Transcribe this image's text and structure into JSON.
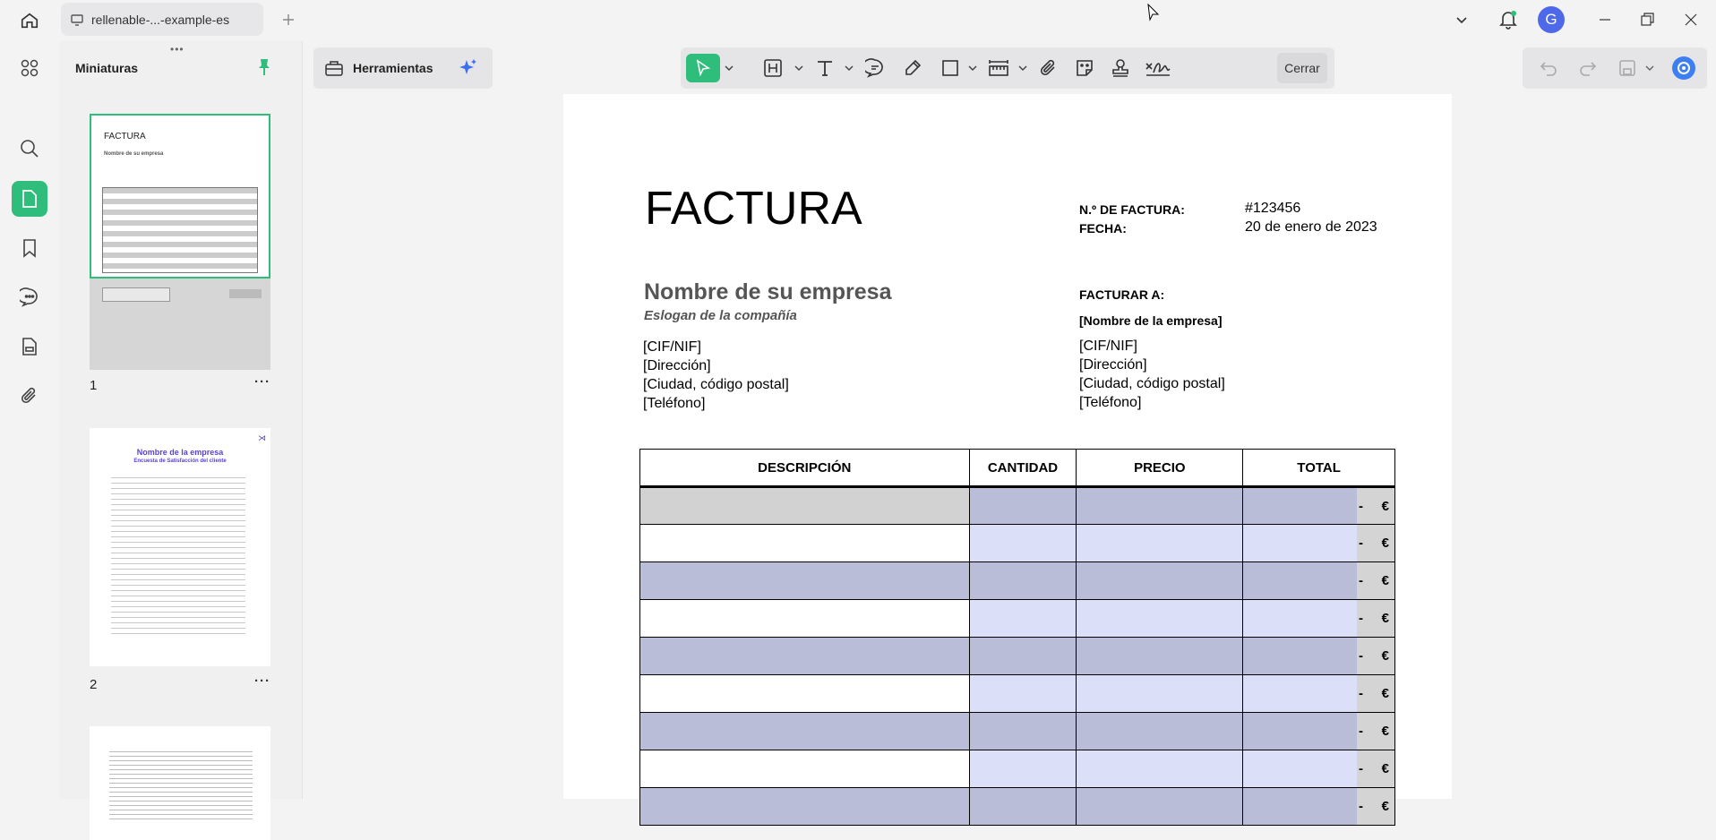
{
  "tab": {
    "title": "rellenable-...-example-es"
  },
  "user": {
    "initial": "G"
  },
  "sidebar": {
    "title": "Miniaturas"
  },
  "thumbnails": [
    {
      "page": "1",
      "heading": "FACTURA",
      "sub": "Nombre de su empresa"
    },
    {
      "page": "2",
      "heading": "Nombre de la empresa",
      "sub": "Encuesta de Satisfacción del cliente"
    }
  ],
  "toolbar": {
    "tools_label": "Herramientas",
    "close_label": "Cerrar"
  },
  "colors": {
    "accent": "#2ebd7a",
    "avatar": "#4e68ea",
    "field_dark": "#b9bdd7",
    "field_light": "#dcdff8"
  },
  "invoice": {
    "title": "FACTURA",
    "number_label": "N.º DE FACTURA:",
    "number_value": "#123456",
    "date_label": "FECHA:",
    "date_value": "20 de enero de 2023",
    "company_name": "Nombre de su empresa",
    "slogan": "Eslogan de la compañía",
    "company_lines": [
      "[CIF/NIF]",
      "[Dirección]",
      "[Ciudad, código postal]",
      "[Teléfono]"
    ],
    "bill_to_label": "FACTURAR A:",
    "bill_to_company": "[Nombre de la empresa]",
    "bill_to_lines": [
      "[CIF/NIF]",
      "[Dirección]",
      "[Ciudad, código postal]",
      "[Teléfono]"
    ],
    "columns": [
      "DESCRIPCIÓN",
      "CANTIDAD",
      "PRECIO",
      "TOTAL"
    ],
    "row_total": "-",
    "currency": "€"
  }
}
